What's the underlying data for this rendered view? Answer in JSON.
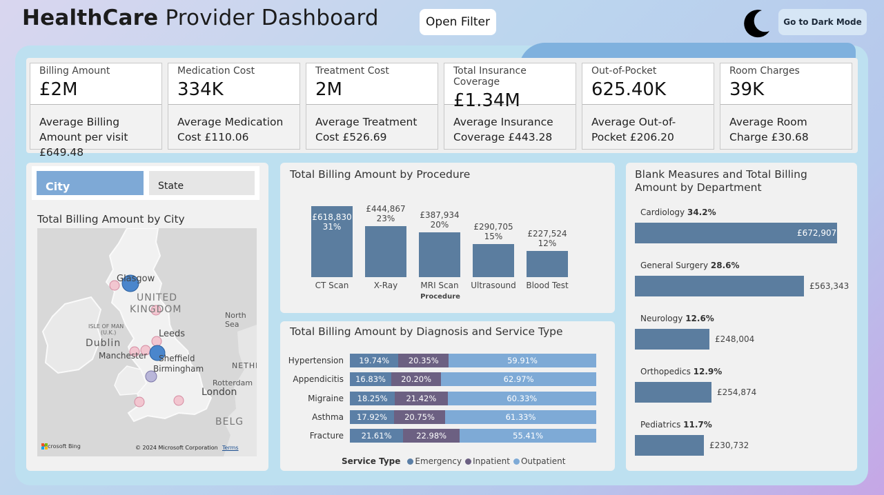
{
  "header": {
    "title_bold": "HealthCare",
    "title_rest": " Provider Dashboard",
    "open_filter_label": "Open Filter",
    "dark_mode_label": "Go to Dark Mode",
    "moon_icon": "moon-icon"
  },
  "kpis": [
    {
      "label": "Billing Amount",
      "value": "£2M",
      "sub": "Average Billing Amount per visit £649.48"
    },
    {
      "label": "Medication Cost",
      "value": "334K",
      "sub": "Average Medication Cost £110.06"
    },
    {
      "label": "Treatment Cost",
      "value": "2M",
      "sub": "Average Treatment Cost £526.69"
    },
    {
      "label": "Total Insurance Coverage",
      "value": "£1.34M",
      "sub": "Average Insurance Coverage £443.28"
    },
    {
      "label": "Out-of-Pocket",
      "value": "625.40K",
      "sub": "Average Out-of-Pocket £206.20"
    },
    {
      "label": "Room Charges",
      "value": "39K",
      "sub": "Average Room Charge £30.68"
    }
  ],
  "segment": {
    "city": "City",
    "state": "State"
  },
  "map": {
    "title": "Total Billing Amount by City",
    "labels": {
      "glasgow": "Glasgow",
      "uk1": "UNITED",
      "uk2": "KINGDOM",
      "north_sea": "North Sea",
      "isle_of_man1": "ISLE OF MAN",
      "isle_of_man2": "(U.K.)",
      "dublin": "Dublin",
      "leeds": "Leeds",
      "manchester": "Manchester",
      "sheffield": "Sheffield",
      "birmingham": "Birmingham",
      "netherlands": "NETHE",
      "rotterdam": "Rotterdam",
      "london": "London",
      "belgium": "BELG"
    },
    "bing": "Microsoft Bing",
    "copyright": "© 2024 Microsoft Corporation",
    "terms": "Terms"
  },
  "procedure_chart": {
    "title": "Total Billing Amount by Procedure",
    "xlabel": "Procedure"
  },
  "diagnosis_chart": {
    "title": "Total Billing Amount by Diagnosis and Service Type",
    "legend_title": "Service Type"
  },
  "department_chart": {
    "title": "Blank Measures and Total Billing Amount by Department"
  },
  "colors": {
    "bar": "#5b7d9f",
    "emergency": "#5b7fa6",
    "inpatient": "#6c6082",
    "outpatient": "#7eaad6"
  },
  "chart_data": [
    {
      "type": "bar",
      "title": "Total Billing Amount by Procedure",
      "xlabel": "Procedure",
      "categories": [
        "CT Scan",
        "X-Ray",
        "MRI Scan",
        "Ultrasound",
        "Blood Test"
      ],
      "values": [
        618830,
        444867,
        387934,
        290705,
        227524
      ],
      "value_labels": [
        "£618,830",
        "£444,867",
        "£387,934",
        "£290,705",
        "£227,524"
      ],
      "percent_labels": [
        "31%",
        "23%",
        "20%",
        "15%",
        "12%"
      ]
    },
    {
      "type": "bar",
      "stacked": true,
      "orientation": "horizontal",
      "title": "Total Billing Amount by Diagnosis and Service Type",
      "categories": [
        "Hypertension",
        "Appendicitis",
        "Migraine",
        "Asthma",
        "Fracture"
      ],
      "series": [
        {
          "name": "Emergency",
          "values": [
            19.74,
            16.83,
            18.25,
            17.92,
            21.61
          ]
        },
        {
          "name": "Inpatient",
          "values": [
            20.35,
            20.2,
            21.42,
            20.75,
            22.98
          ]
        },
        {
          "name": "Outpatient",
          "values": [
            59.91,
            62.97,
            60.33,
            61.33,
            55.41
          ]
        }
      ],
      "legend_title": "Service Type",
      "legend_position": "bottom"
    },
    {
      "type": "bar",
      "orientation": "horizontal",
      "title": "Blank Measures and Total Billing Amount by Department",
      "categories": [
        "Cardiology",
        "General Surgery",
        "Neurology",
        "Orthopedics",
        "Pediatrics"
      ],
      "percents": [
        "34.2%",
        "28.6%",
        "12.6%",
        "12.9%",
        "11.7%"
      ],
      "values": [
        672907,
        563343,
        248004,
        254874,
        230732
      ],
      "value_labels": [
        "£672,907",
        "£563,343",
        "£248,004",
        "£254,874",
        "£230,732"
      ]
    }
  ]
}
